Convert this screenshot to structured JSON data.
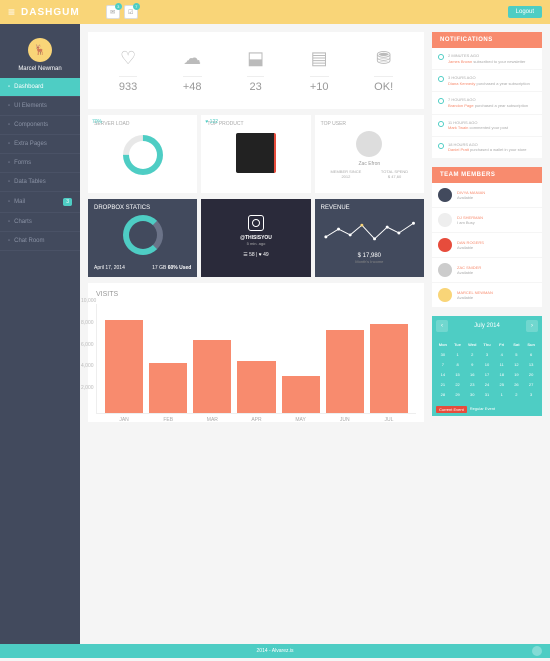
{
  "brand": "DASHGUM",
  "top_badges": {
    "mail": "3",
    "tasks": "7"
  },
  "logout": "Logout",
  "user": {
    "name": "Marcel Newman"
  },
  "menu": [
    {
      "label": "Dashboard",
      "active": true
    },
    {
      "label": "UI Elements"
    },
    {
      "label": "Components"
    },
    {
      "label": "Extra Pages"
    },
    {
      "label": "Forms"
    },
    {
      "label": "Data Tables"
    },
    {
      "label": "Mail",
      "badge": "3"
    },
    {
      "label": "Charts"
    },
    {
      "label": "Chat Room"
    }
  ],
  "stats": [
    {
      "icon": "heart",
      "value": "933"
    },
    {
      "icon": "cloud",
      "value": "+48"
    },
    {
      "icon": "inbox",
      "value": "23"
    },
    {
      "icon": "news",
      "value": "+10"
    },
    {
      "icon": "database",
      "value": "OK!"
    }
  ],
  "server": {
    "title": "SERVER LOAD",
    "pct": "70%"
  },
  "product": {
    "title": "TOP PRODUCT",
    "likes": "♥ 122"
  },
  "topuser": {
    "title": "TOP USER",
    "name": "Zac Efron",
    "m1": "MEMBER SINCE",
    "m1v": "2012",
    "m2": "TOTAL SPEND",
    "m2v": "$ 47,60"
  },
  "dropbox": {
    "title": "DROPBOX STATICS",
    "date": "April 17, 2014",
    "size": "17 GB",
    "used": "60% Used"
  },
  "insta": {
    "user": "@THISISYOU",
    "time": "5 min. ago",
    "stats": "☰ 58 | ♥ 49"
  },
  "revenue": {
    "title": "REVENUE",
    "value": "$ 17,980",
    "sub": "Month's Income"
  },
  "visits": {
    "title": "VISITS"
  },
  "chart_data": {
    "type": "bar",
    "categories": [
      "JAN",
      "FEB",
      "MAR",
      "APR",
      "MAY",
      "JUN",
      "JUL"
    ],
    "values": [
      8500,
      4600,
      6700,
      4800,
      3400,
      7600,
      8200
    ],
    "title": "VISITS",
    "ylabel": "",
    "yticks": [
      2000,
      4000,
      6000,
      8000,
      10000
    ],
    "ylim": [
      0,
      10000
    ]
  },
  "notifications": {
    "title": "NOTIFICATIONS",
    "items": [
      {
        "time": "2 MINUTES AGO",
        "who": "James Brown",
        "txt": "subscribed to your newsletter"
      },
      {
        "time": "3 HOURS AGO",
        "who": "Diana Kennedy",
        "txt": "purchased a year subscription"
      },
      {
        "time": "7 HOURS AGO",
        "who": "Brandon Page",
        "txt": "purchased a year subscription"
      },
      {
        "time": "11 HOURS AGO",
        "who": "Mark Twain",
        "txt": "commented your post"
      },
      {
        "time": "18 HOURS AGO",
        "who": "Daniel Pratt",
        "txt": "purchased a wallet in your store"
      }
    ]
  },
  "team": {
    "title": "TEAM MEMBERS",
    "items": [
      {
        "name": "DIVYA MANIAN",
        "status": "Available"
      },
      {
        "name": "DJ SHERMAN",
        "status": "I am Busy"
      },
      {
        "name": "DAN ROGERS",
        "status": "Available"
      },
      {
        "name": "ZAC SNIDER",
        "status": "Available"
      },
      {
        "name": "MARCEL NEWMAN",
        "status": "Available"
      }
    ]
  },
  "calendar": {
    "month": "July 2014",
    "days": [
      "Mon",
      "Tue",
      "Wed",
      "Thu",
      "Fri",
      "Sat",
      "Sun"
    ],
    "cells": [
      "30",
      "1",
      "2",
      "3",
      "4",
      "5",
      "6",
      "7",
      "8",
      "9",
      "10",
      "11",
      "12",
      "13",
      "14",
      "15",
      "16",
      "17",
      "18",
      "19",
      "20",
      "21",
      "22",
      "23",
      "24",
      "25",
      "26",
      "27",
      "28",
      "29",
      "30",
      "31",
      "1",
      "2",
      "3"
    ],
    "tags": [
      "Current Event",
      "Regular Event"
    ]
  },
  "footer": "2014 - Alvarez.is"
}
